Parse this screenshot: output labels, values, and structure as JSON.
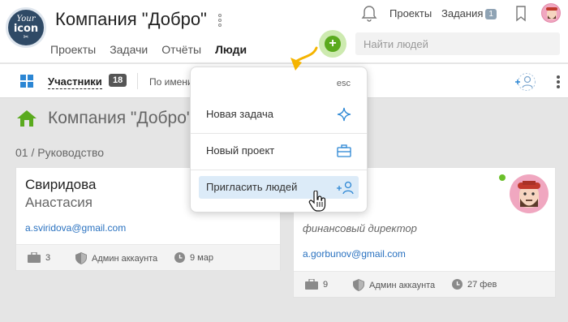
{
  "header": {
    "logo": {
      "line1": "Your",
      "line2": "icon",
      "line3": "✂"
    },
    "company_title": "Компания \"Добро\"",
    "nav": [
      "Проекты",
      "Задачи",
      "Отчёты",
      "Люди"
    ],
    "active_nav": "Люди",
    "top_links": {
      "projects": "Проекты",
      "tasks": "Задания",
      "tasks_count": "1"
    },
    "search_placeholder": "Найти людей"
  },
  "toolbar": {
    "members_label": "Участники",
    "members_count": "18",
    "sort_label": "По имени"
  },
  "content": {
    "section_title": "Компания \"Добро\"",
    "group_title": "01 / Руководство"
  },
  "cards": [
    {
      "first_line": "Свиридова",
      "second_line": "Анастасия",
      "email": "a.sviridova@gmail.com",
      "projects": "3",
      "role_badge": "Админ аккаунта",
      "date": "9 мар"
    },
    {
      "role": "финансовый директор",
      "email": "a.gorbunov@gmail.com",
      "projects": "9",
      "role_badge": "Админ аккаунта",
      "date": "27 фев",
      "online": true
    }
  ],
  "dropdown": {
    "esc": "esc",
    "items": [
      {
        "label": "Новая задача",
        "icon": "sparkle-icon"
      },
      {
        "label": "Новый проект",
        "icon": "briefcase-icon"
      },
      {
        "label": "Пригласить людей",
        "icon": "add-person-icon",
        "highlighted": true
      }
    ]
  },
  "colors": {
    "accent_blue": "#2b86d4",
    "green": "#5aaa1e",
    "link": "#2a72c0",
    "highlight": "#dcebf8",
    "arrow": "#f5b400"
  }
}
